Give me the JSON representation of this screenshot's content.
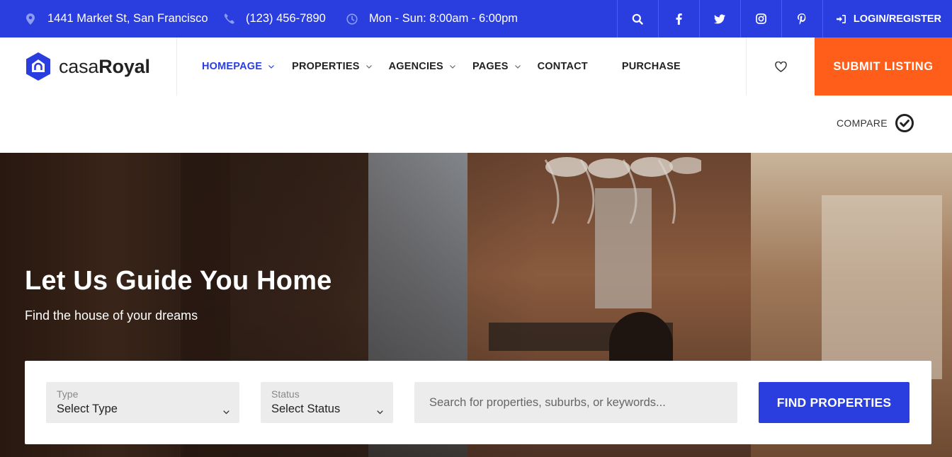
{
  "topbar": {
    "address": "1441 Market St, San Francisco",
    "phone": "(123) 456-7890",
    "hours": "Mon - Sun: 8:00am - 6:00pm",
    "login_label": "LOGIN/REGISTER",
    "icons": [
      "map-pin-icon",
      "phone-icon",
      "clock-icon",
      "search-icon",
      "facebook-icon",
      "twitter-icon",
      "instagram-icon",
      "pinterest-icon",
      "login-icon"
    ],
    "colors": {
      "bar": "#2a3ee0"
    }
  },
  "header": {
    "logo": {
      "light": "casa",
      "bold": "Royal"
    },
    "nav": [
      {
        "label": "HOMEPAGE",
        "has_dropdown": true,
        "active": true
      },
      {
        "label": "PROPERTIES",
        "has_dropdown": true
      },
      {
        "label": "AGENCIES",
        "has_dropdown": true
      },
      {
        "label": "PAGES",
        "has_dropdown": true
      },
      {
        "label": "CONTACT",
        "has_dropdown": false
      },
      {
        "label": "PURCHASE",
        "has_dropdown": false
      }
    ],
    "submit_label": "SUBMIT LISTING",
    "colors": {
      "accent": "#2a3ee0",
      "submit": "#ff5e1a"
    }
  },
  "compare": {
    "label": "COMPARE"
  },
  "hero": {
    "title": "Let Us Guide You Home",
    "subtitle": "Find the house of your dreams"
  },
  "search": {
    "type": {
      "label": "Type",
      "value": "Select Type"
    },
    "status": {
      "label": "Status",
      "value": "Select Status"
    },
    "placeholder": "Search for properties, suburbs, or keywords...",
    "button_label": "FIND PROPERTIES"
  }
}
